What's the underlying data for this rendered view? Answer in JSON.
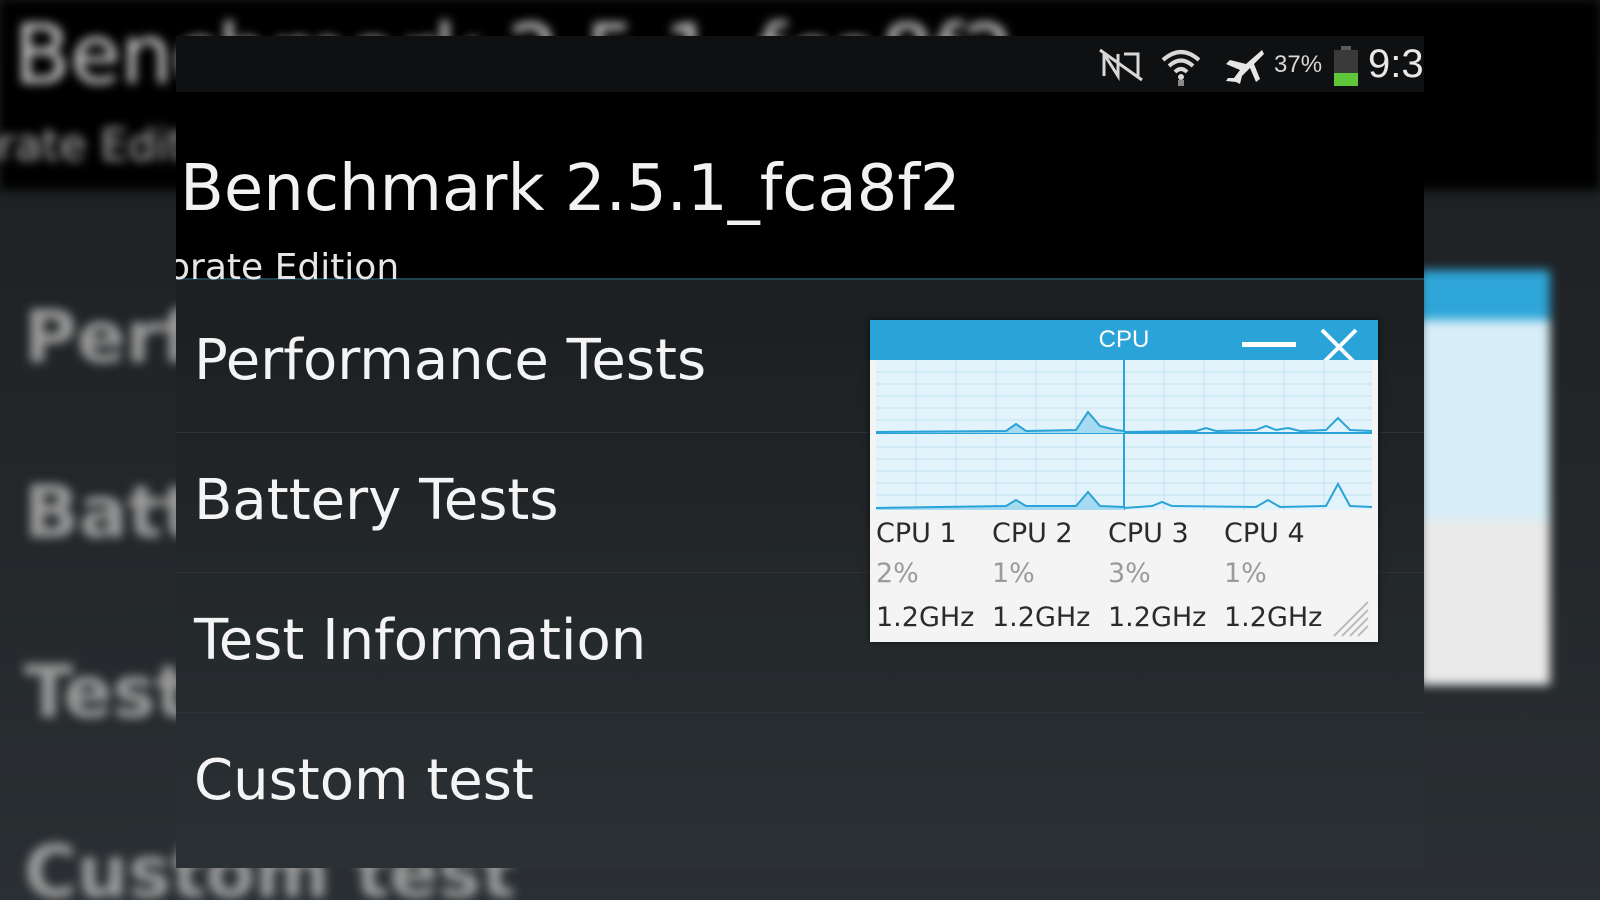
{
  "background": {
    "title": "Benchmark 2.5.1_fca8f2",
    "subtitle": "orate Edition",
    "items": [
      "Perf",
      "Batt",
      "Test",
      "Custom test"
    ]
  },
  "status_bar": {
    "icons": [
      "nfc-off-icon",
      "wifi-icon",
      "airplane-mode-icon",
      "battery-icon"
    ],
    "battery_percent": "37%",
    "battery_level": 0.37,
    "clock": "9:3",
    "battery_color": "#5fc63a"
  },
  "app": {
    "title": "Benchmark 2.5.1_fca8f2",
    "subtitle": "orate Edition"
  },
  "menu": {
    "items": [
      {
        "label": "Performance Tests"
      },
      {
        "label": "Battery Tests"
      },
      {
        "label": "Test Information"
      },
      {
        "label": "Custom test"
      }
    ]
  },
  "cpu_widget": {
    "title": "CPU",
    "accent_color": "#2aa3d8",
    "cores": [
      {
        "name": "CPU 1",
        "usage": "2%",
        "freq": "1.2GHz"
      },
      {
        "name": "CPU 2",
        "usage": "1%",
        "freq": "1.2GHz"
      },
      {
        "name": "CPU 3",
        "usage": "3%",
        "freq": "1.2GHz"
      },
      {
        "name": "CPU 4",
        "usage": "1%",
        "freq": "1.2GHz"
      }
    ]
  }
}
